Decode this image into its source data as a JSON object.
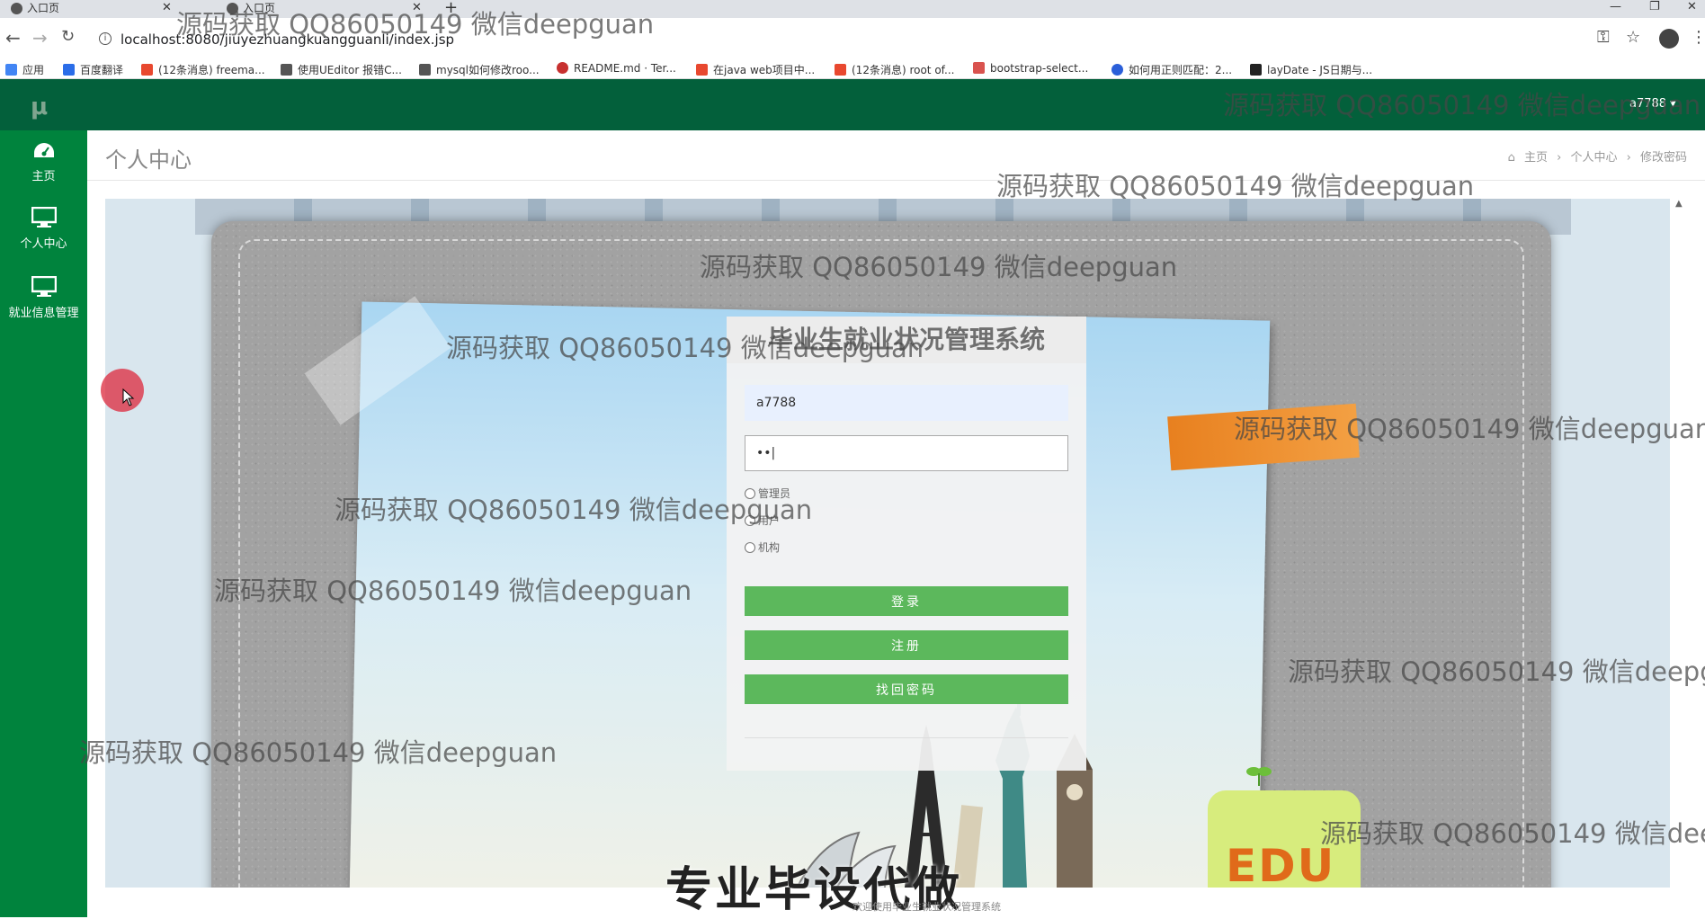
{
  "browser": {
    "tabs": [
      {
        "label": "入口页"
      },
      {
        "label": "入口页"
      }
    ],
    "url": "localhost:8080/jiuyezhuangkuangguanli/index.jsp",
    "bookmarks": [
      {
        "label": "应用",
        "color": "#4285f4"
      },
      {
        "label": "百度翻译",
        "color": "#2b6de8"
      },
      {
        "label": "(12条消息) freema...",
        "color": "#e8482f"
      },
      {
        "label": "使用UEditor 报错C...",
        "color": "#555555"
      },
      {
        "label": "mysql如何修改roo...",
        "color": "#555555"
      },
      {
        "label": "README.md · Ter...",
        "color": "#c7302f"
      },
      {
        "label": "在java web项目中...",
        "color": "#e8482f"
      },
      {
        "label": "(12条消息) root of...",
        "color": "#e8482f"
      },
      {
        "label": "bootstrap-select...",
        "color": "#d9534f"
      },
      {
        "label": "如何用正则匹配：2...",
        "color": "#2b5fd9"
      },
      {
        "label": "layDate - JS日期与...",
        "color": "#222222"
      }
    ]
  },
  "app": {
    "logo": "μ",
    "user_menu": "a7788 ▾",
    "sidebar": [
      {
        "label": "主页"
      },
      {
        "label": "个人中心"
      },
      {
        "label": "就业信息管理"
      }
    ],
    "page_title": "个人中心",
    "breadcrumb": {
      "home": "主页",
      "sep": "›",
      "level1": "个人中心",
      "level2": "修改密码"
    }
  },
  "login": {
    "title": "毕业生就业状况管理系统",
    "username": "a7788",
    "password": "••|",
    "roles": [
      "管理员",
      "用户",
      "机构"
    ],
    "login_button": "登录",
    "register_button": "注册",
    "recover_button": "找回密码"
  },
  "landmark_text": "EDU",
  "footer": {
    "banner": "专业毕设代做",
    "welcome": "欢迎使用毕业生就业状况管理系统"
  },
  "watermark": "源码获取 QQ86050149 微信deepguan",
  "colors": {
    "header": "#03603b",
    "sidebar": "#00833d",
    "button": "#5cb85c"
  }
}
